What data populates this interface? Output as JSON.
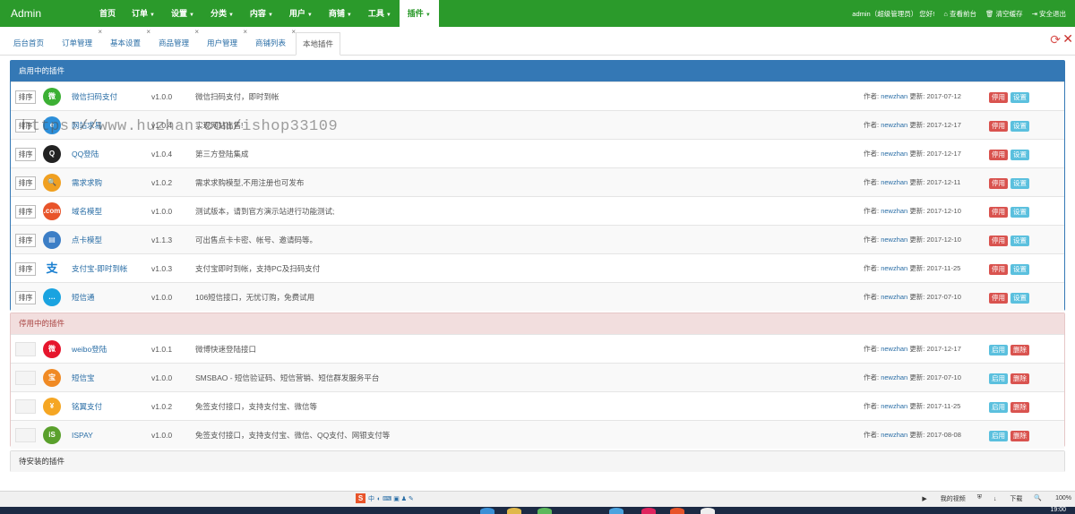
{
  "brand": "Admin",
  "menu": [
    {
      "label": "首页",
      "active": false
    },
    {
      "label": "订单",
      "active": false
    },
    {
      "label": "设置",
      "active": false
    },
    {
      "label": "分类",
      "active": false
    },
    {
      "label": "内容",
      "active": false
    },
    {
      "label": "用户",
      "active": false
    },
    {
      "label": "商铺",
      "active": false
    },
    {
      "label": "工具",
      "active": false
    },
    {
      "label": "插件",
      "active": true
    }
  ],
  "top_right": {
    "user": "admin（超级管理员） 您好!",
    "view_front": "查看前台",
    "clear_cache": "清空缓存",
    "logout": "安全退出"
  },
  "tabs": [
    {
      "label": "后台首页"
    },
    {
      "label": "订单管理"
    },
    {
      "label": "基本设置"
    },
    {
      "label": "商品管理"
    },
    {
      "label": "用户管理"
    },
    {
      "label": "商铺列表"
    },
    {
      "label": "本地插件"
    }
  ],
  "enabled_panel": {
    "title": "启用中的插件",
    "sort_label": "排序",
    "btn_disable": "停用",
    "btn_settings": "设置",
    "author_prefix": "作者:",
    "updated_prefix": "更新:",
    "rows": [
      {
        "name": "微信扫码支付",
        "version": "v1.0.0",
        "desc": "微信扫码支付，即时到帐",
        "author": "newzhan",
        "date": "2017-07-12",
        "icon": "wechat-icon",
        "color": "#3cb034",
        "glyph": "微"
      },
      {
        "name": "网站求易",
        "version": "v1.0.4",
        "desc": "实现网站出售!",
        "author": "newzhan",
        "date": "2017-12-17",
        "icon": "ie-icon",
        "color": "#2d8fd9",
        "glyph": "e"
      },
      {
        "name": "QQ登陆",
        "version": "v1.0.4",
        "desc": "第三方登陆集成",
        "author": "newzhan",
        "date": "2017-12-17",
        "icon": "qq-icon",
        "color": "#222222",
        "glyph": "Q"
      },
      {
        "name": "需求求购",
        "version": "v1.0.2",
        "desc": "需求求购模型,不用注册也可发布",
        "author": "newzhan",
        "date": "2017-12-11",
        "icon": "magnifier-icon",
        "color": "#f0a020",
        "glyph": "🔍"
      },
      {
        "name": "域名模型",
        "version": "v1.0.0",
        "desc": "测试版本，请到官方演示站进行功能测试;",
        "author": "newzhan",
        "date": "2017-12-10",
        "icon": "dotcom-icon",
        "color": "#e8542a",
        "glyph": ".com"
      },
      {
        "name": "点卡模型",
        "version": "v1.1.3",
        "desc": "可出售点卡卡密、帐号、邀请码等。",
        "author": "newzhan",
        "date": "2017-12-10",
        "icon": "card-icon",
        "color": "#3c7ec6",
        "glyph": "▤"
      },
      {
        "name": "支付宝-即时到帐",
        "version": "v1.0.3",
        "desc": "支付宝即时到帐，支持PC及扫码支付",
        "author": "newzhan",
        "date": "2017-11-25",
        "icon": "alipay-icon",
        "color": "#ffffff",
        "glyph": "支"
      },
      {
        "name": "短信通",
        "version": "v1.0.0",
        "desc": "106短信接口，无忧订购，免费试用",
        "author": "newzhan",
        "date": "2017-07-10",
        "icon": "chat-bubble-icon",
        "color": "#1aa3e0",
        "glyph": "…"
      }
    ]
  },
  "disabled_panel": {
    "title": "停用中的插件",
    "btn_enable": "启用",
    "btn_delete": "删除",
    "author_prefix": "作者:",
    "updated_prefix": "更新:",
    "rows": [
      {
        "name": "weibo登陆",
        "version": "v1.0.1",
        "desc": "微博快速登陆接口",
        "author": "newzhan",
        "date": "2017-12-17",
        "icon": "weibo-icon",
        "color": "#e6162d",
        "glyph": "微"
      },
      {
        "name": "短信宝",
        "version": "v1.0.0",
        "desc": "SMSBAO - 短信验证码、短信营销、短信群发服务平台",
        "author": "newzhan",
        "date": "2017-07-10",
        "icon": "smsbao-icon",
        "color": "#f08a24",
        "glyph": "宝"
      },
      {
        "name": "铭翼支付",
        "version": "v1.0.2",
        "desc": "免签支付接口，支持支付宝、微信等",
        "author": "newzhan",
        "date": "2017-11-25",
        "icon": "coin-icon",
        "color": "#f5a623",
        "glyph": "¥"
      },
      {
        "name": "ISPAY",
        "version": "v1.0.0",
        "desc": "免签支付接口，支持支付宝、微信、QQ支付、网银支付等",
        "author": "newzhan",
        "date": "2017-08-08",
        "icon": "ispay-icon",
        "color": "#5aa02c",
        "glyph": "iS"
      }
    ]
  },
  "uninstalled_panel": {
    "title": "待安装的插件"
  },
  "watermark": "https://www.huzhan.com/ishop33109",
  "statusbar": {
    "ime": "中",
    "video": "我的视频",
    "download": "下载",
    "zoom": "100%"
  },
  "clock": "19:00"
}
